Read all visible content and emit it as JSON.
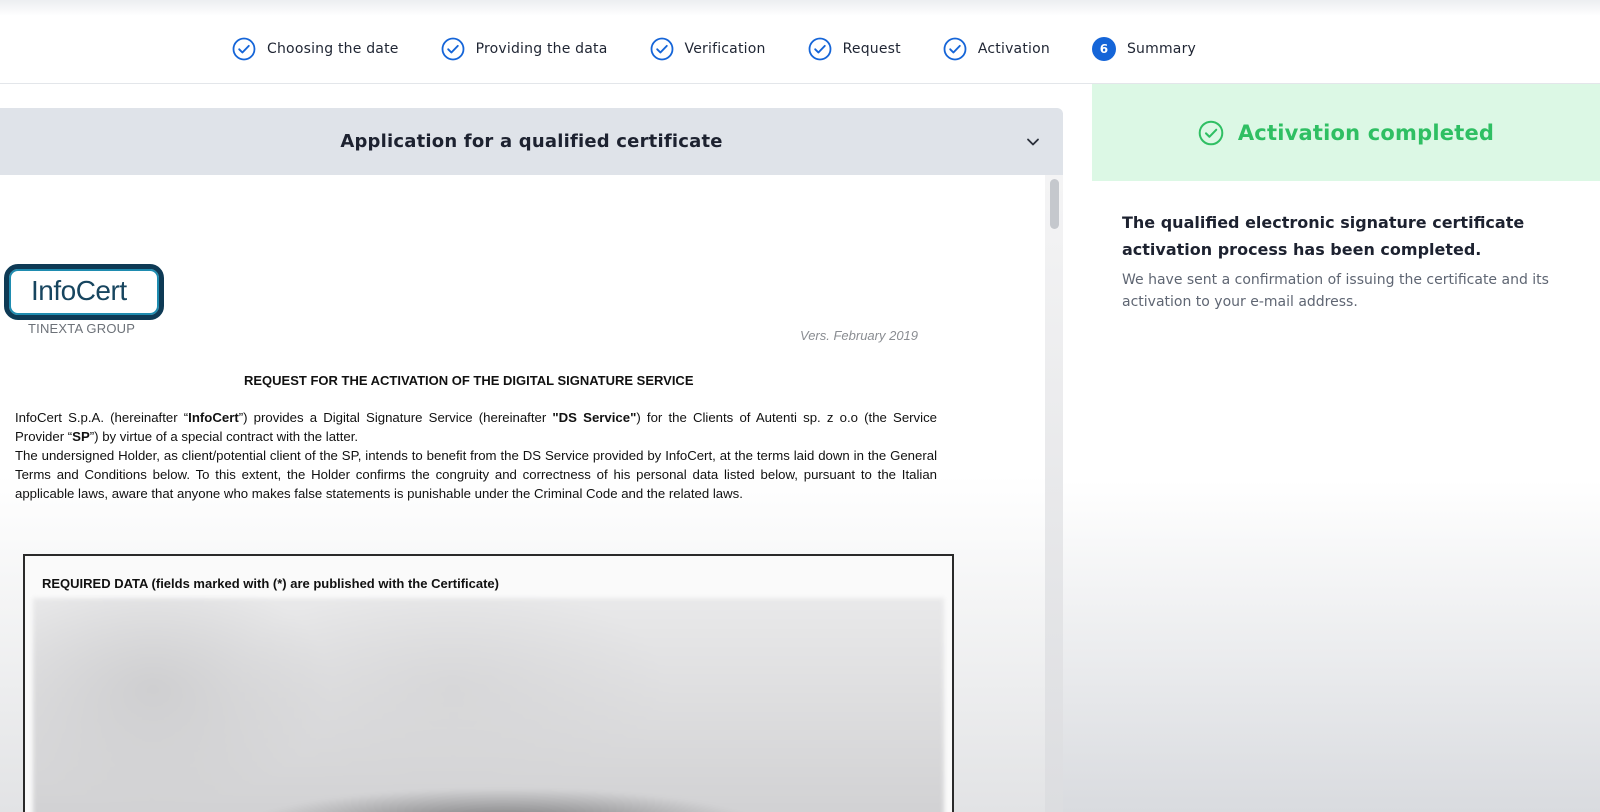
{
  "stepper": {
    "steps": [
      {
        "label": "Choosing the date",
        "state": "done",
        "icon": "check-circle-icon"
      },
      {
        "label": "Providing the data",
        "state": "done",
        "icon": "check-circle-icon"
      },
      {
        "label": "Verification",
        "state": "done",
        "icon": "check-circle-icon"
      },
      {
        "label": "Request",
        "state": "done",
        "icon": "check-circle-icon"
      },
      {
        "label": "Activation",
        "state": "done",
        "icon": "check-circle-icon"
      },
      {
        "label": "Summary",
        "state": "current",
        "number": "6"
      }
    ],
    "accent_color": "#1565d8"
  },
  "document": {
    "title": "Application for a qualified certificate",
    "chevron_icon": "chevron-down-icon",
    "logo": {
      "brand_a": "Info",
      "brand_b": "Cert",
      "subtitle": "TINEXTA GROUP"
    },
    "version": "Vers. February 2019",
    "heading": "REQUEST FOR THE ACTIVATION OF THE DIGITAL SIGNATURE SERVICE",
    "para1": {
      "t1": "InfoCert S.p.A. (hereinafter “",
      "b1": "InfoCert",
      "t2": "”) provides a Digital Signature Service (hereinafter ",
      "b2": "\"DS Service\"",
      "t3": ") for the Clients of Autenti sp. z o.o (the Service Provider “",
      "b3": "SP",
      "t4": "”) by virtue of a special contract with the latter."
    },
    "para2": "The undersigned Holder, as client/potential client of the SP, intends to benefit from the DS Service provided by InfoCert, at the terms laid down in the General Terms and Conditions below. To this extent, the Holder confirms the congruity and correctness of his personal data listed below, pursuant to the Italian applicable laws, aware that anyone who makes false statements is punishable under the Criminal Code and the related laws.",
    "required_title": "REQUIRED DATA (fields marked with (*) are published with the Certificate)"
  },
  "status": {
    "icon": "check-circle-icon",
    "title": "Activation completed",
    "main_text": "The qualified electronic signature certificate activation process has been completed.",
    "sub_text": "We have sent a confirmation of issuing the certificate and its activation to your e-mail address.",
    "color": "#2fbf63",
    "background": "#dcf8e5"
  }
}
